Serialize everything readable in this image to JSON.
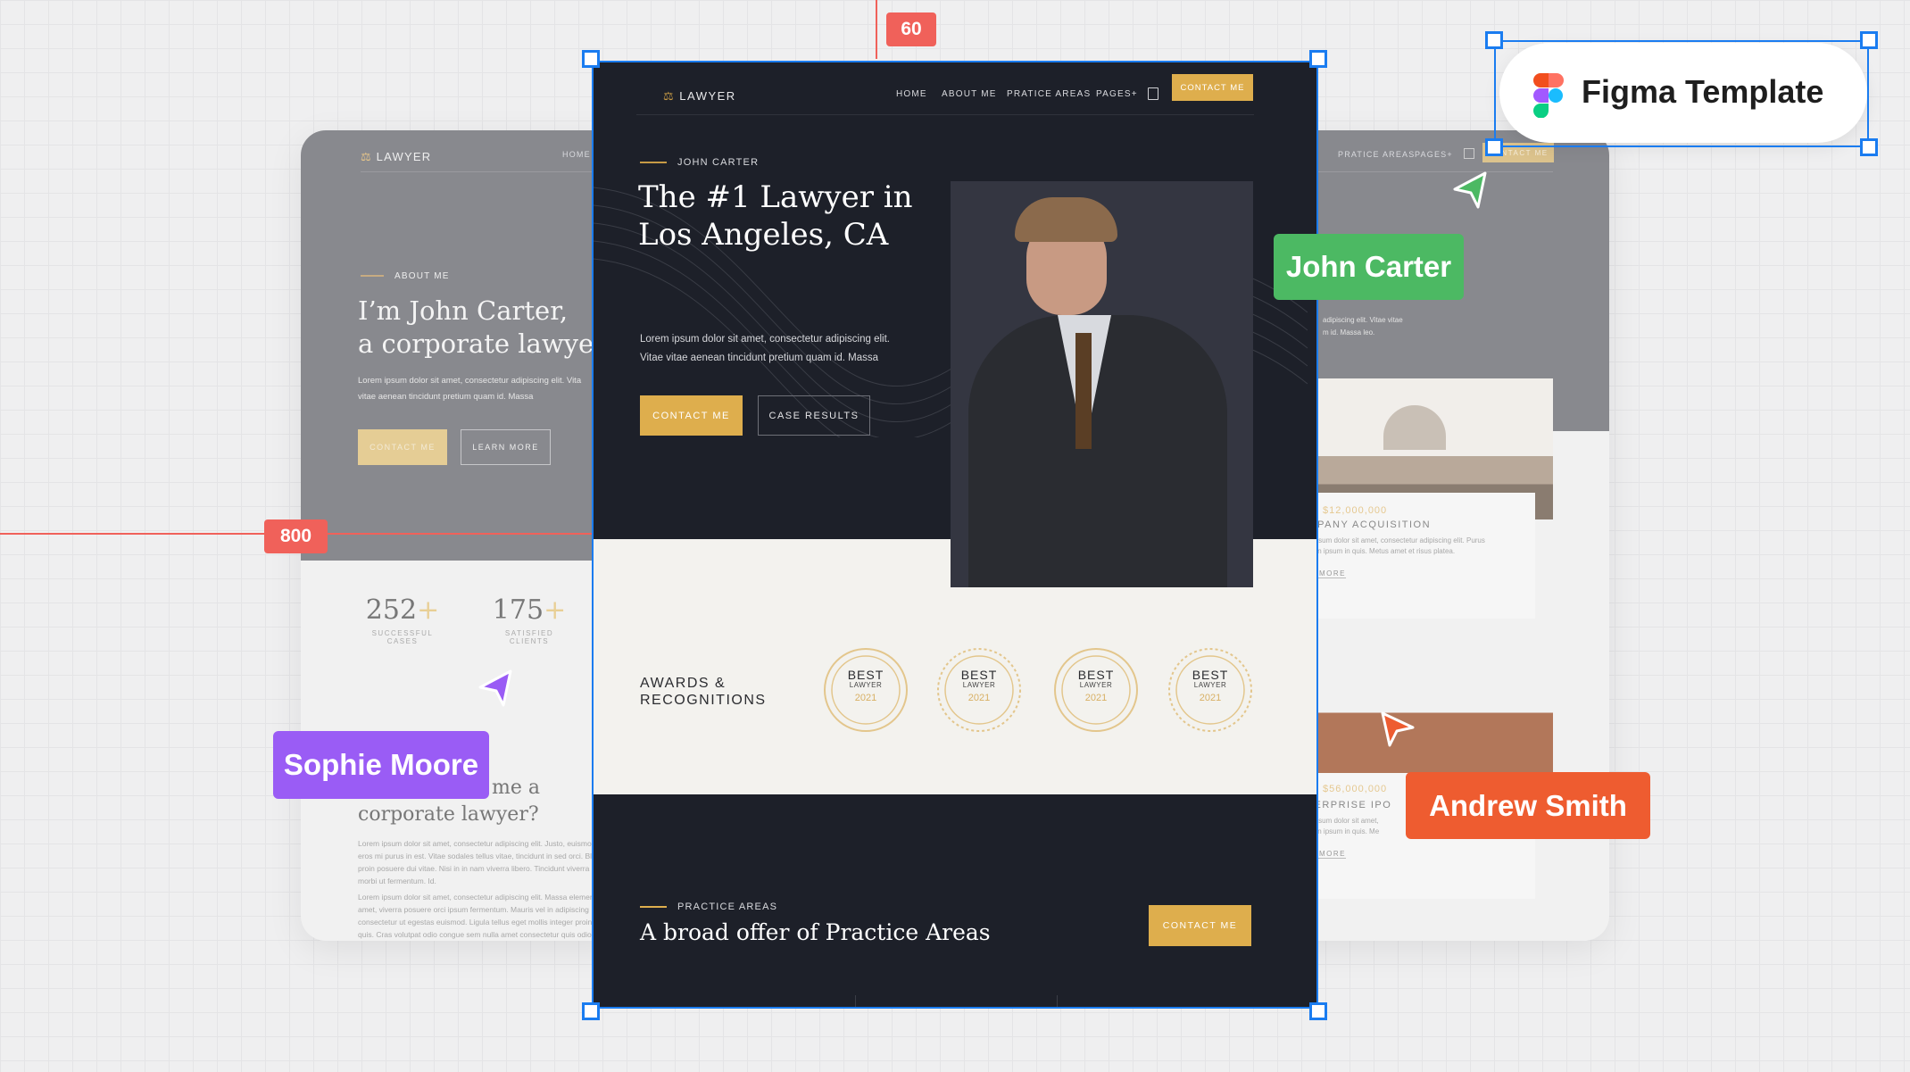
{
  "brand": "LAWYER",
  "colors": {
    "gold": "#deae4d",
    "dark": "#1d2029",
    "selection": "#1a7cf0",
    "measure": "#f0615a",
    "green": "#4cb963",
    "purple": "#9a5cf5",
    "orange": "#ee5c30"
  },
  "nav": {
    "items": [
      "HOME",
      "ABOUT ME",
      "PRATICE AREAS",
      "PAGES+"
    ],
    "cta": "CONTACT ME",
    "cart_icon": "shopping-bag-icon"
  },
  "hero": {
    "eyebrow": "JOHN CARTER",
    "title_1": "The #1 Lawyer in",
    "title_2": "Los Angeles, CA",
    "body_1": "Lorem ipsum dolor sit amet, consectetur adipiscing elit.",
    "body_2": "Vitae vitae aenean tincidunt pretium quam id. Massa",
    "primary": "CONTACT ME",
    "secondary": "CASE RESULTS"
  },
  "awards": {
    "title_1": "AWARDS &",
    "title_2": "RECOGNITIONS",
    "badges": [
      {
        "top": "BEST",
        "mid": "LAWYER",
        "year": "2021"
      },
      {
        "top": "BEST",
        "mid": "LAWYER",
        "year": "2021"
      },
      {
        "top": "BEST",
        "mid": "LAWYER",
        "year": "2021"
      },
      {
        "top": "BEST",
        "mid": "LAWYER",
        "year": "2021"
      }
    ]
  },
  "practice": {
    "eyebrow": "PRACTICE AREAS",
    "title": "A broad offer of Practice Areas",
    "cta": "CONTACT ME"
  },
  "left_page": {
    "nav_home": "HOME",
    "eyebrow": "ABOUT ME",
    "title_1": "I’m John Carter,",
    "title_2": "a corporate lawyer",
    "body_1": "Lorem ipsum dolor sit amet, consectetur adipiscing elit. Vita",
    "body_2": "vitae aenean tincidunt pretium quam id. Massa",
    "primary": "CONTACT ME",
    "secondary": "LEARN MORE",
    "stats": [
      {
        "value": "252",
        "suffix": "+",
        "label": "SUCCESSFUL CASES"
      },
      {
        "value": "175",
        "suffix": "+",
        "label": "SATISFIED CLIENTS"
      }
    ],
    "q_title_1": "me a",
    "q_title_2": "corporate lawyer?",
    "para_1": [
      "Lorem ipsum dolor sit amet, consectetur adipiscing elit. Justo, euismod felis",
      "eros mi purus in est. Vitae sodales tellus vitae, tincidunt in sed orci. Blandit",
      "proin posuere dui vitae. Nisi in in nam viverra libero. Tincidunt viverra cong",
      "morbi ut fermentum. Id."
    ],
    "para_2": [
      "Lorem ipsum dolor sit amet, consectetur adipiscing elit. Massa elementum",
      "amet, viverra posuere orci ipsum fermentum. Mauris vel in adipiscing",
      "consectetur ut egestas euismod. Ligula tellus eget mollis integer proin enim",
      "quis. Cras volutpat odio congue sem nulla amet consectetur quis odio eu."
    ]
  },
  "right_page": {
    "nav": [
      "PRATICE AREAS",
      "PAGES+"
    ],
    "cta": "CONTACT ME",
    "body_1": "adipiscing elit. Vitae vitae",
    "body_2": "m id. Massa leo.",
    "cases": [
      {
        "amount": "$12,000,000",
        "title": "COMPANY ACQUISITION",
        "desc_1": "Lorem ipsum dolor sit amet, consectetur adipiscing elit. Purus",
        "desc_2": "gravida in ipsum in quis. Metus amet et risus platea.",
        "link": "READ MORE"
      },
      {
        "amount": "$56,000,000",
        "title": "ENTERPRISE IPO",
        "desc_1": "Lorem ipsum dolor sit amet,",
        "desc_2": "gravida in ipsum in quis. Me",
        "link": "READ MORE"
      }
    ]
  },
  "overlays": {
    "measure_top": "60",
    "measure_left": "800",
    "figma_label": "Figma Template",
    "users": [
      "John Carter",
      "Sophie Moore",
      "Andrew Smith"
    ]
  }
}
